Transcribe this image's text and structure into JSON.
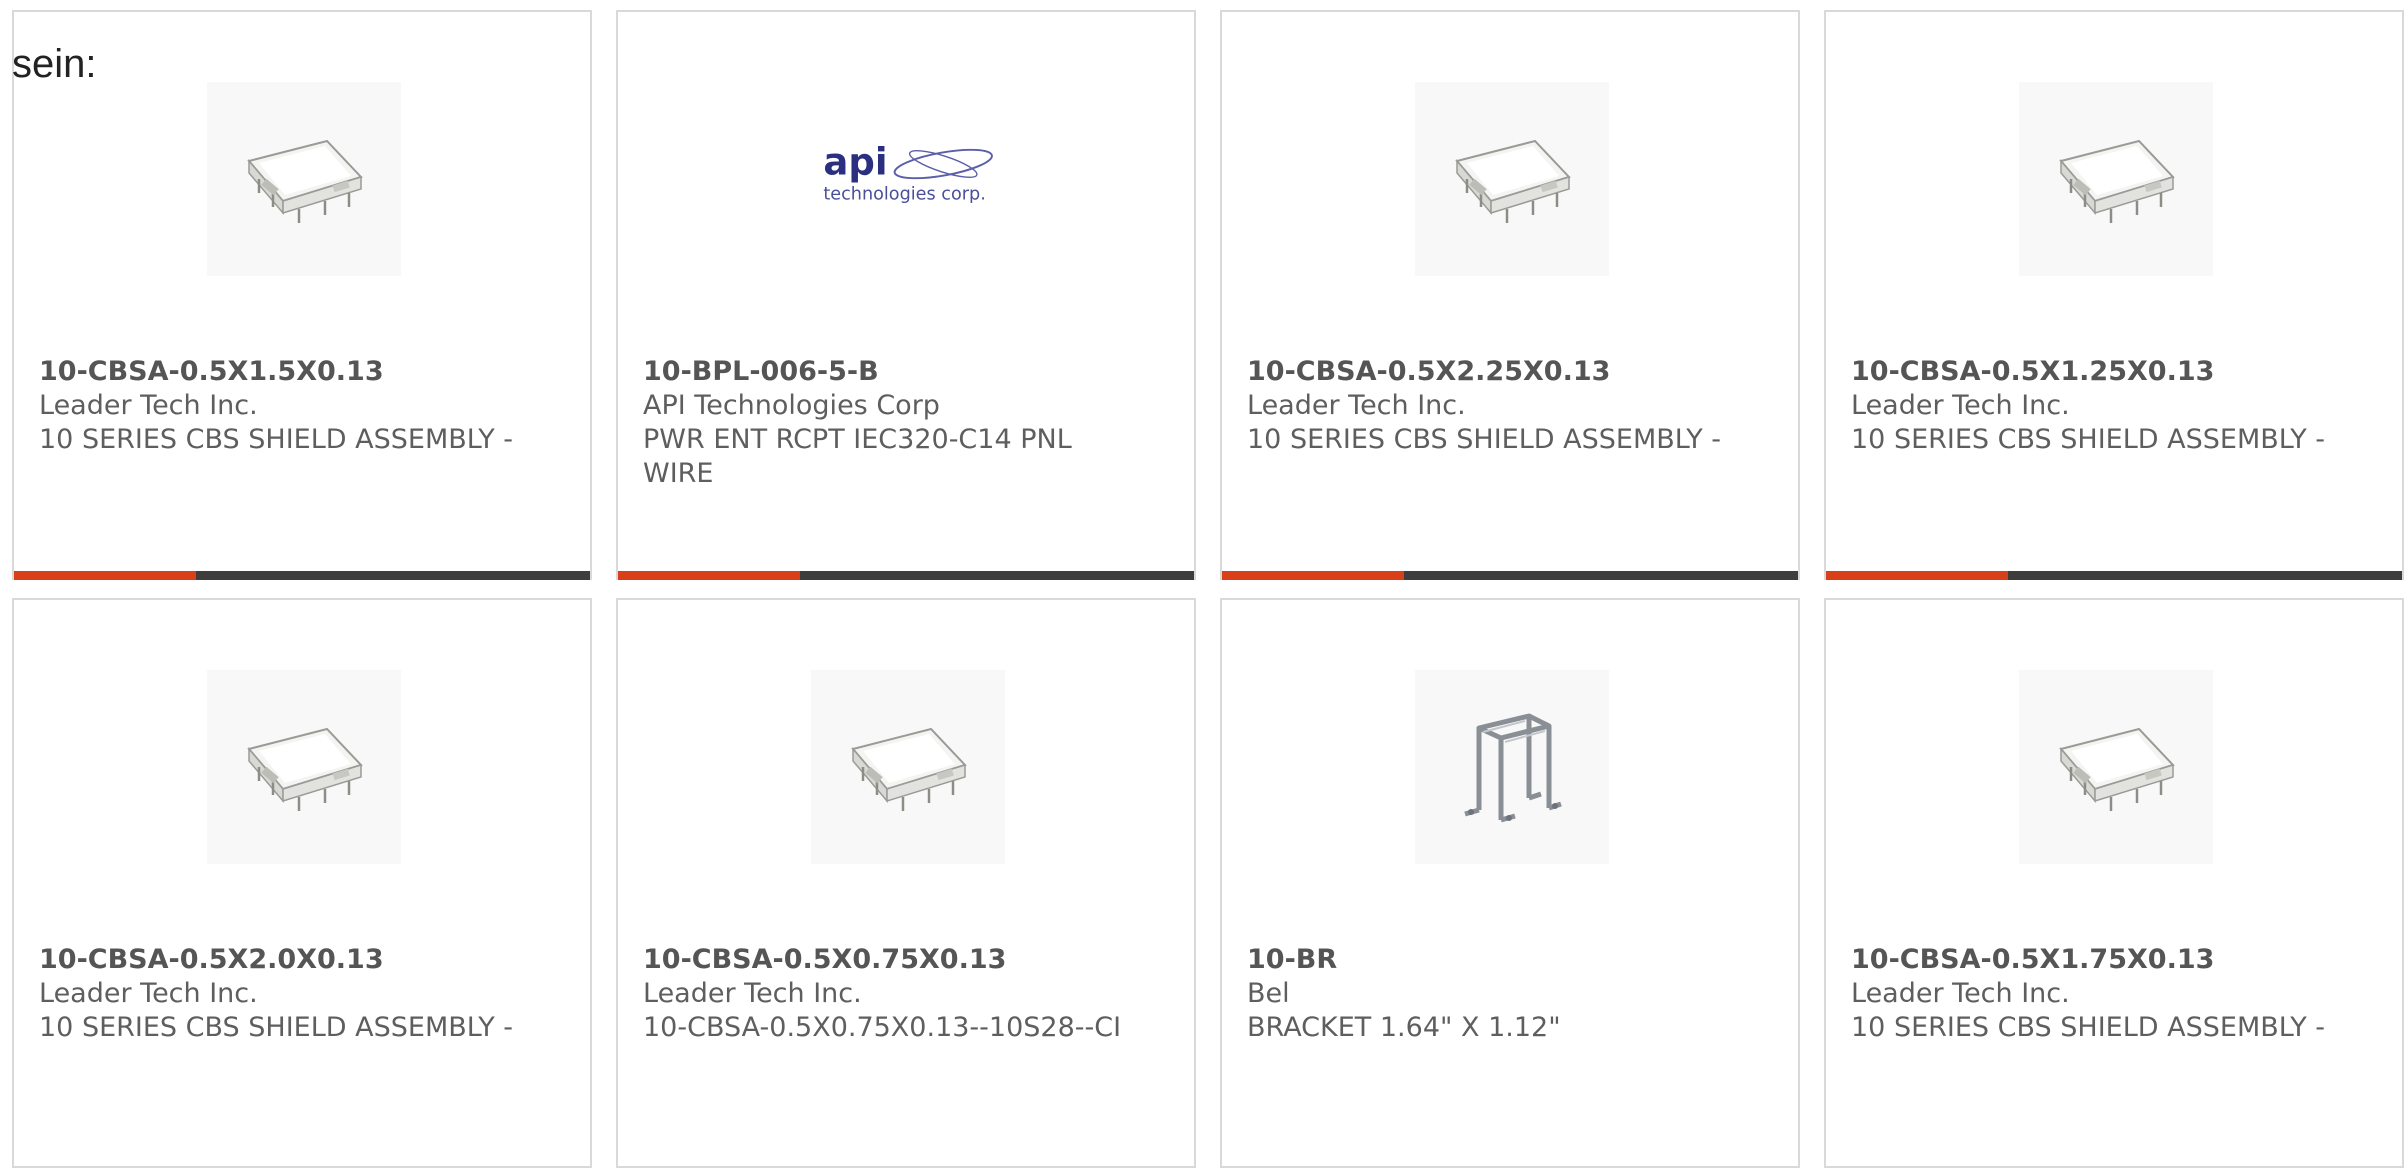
{
  "intro_text": "sein:",
  "products": [
    {
      "part": "10-CBSA-0.5X1.5X0.13",
      "manufacturer": "Leader Tech Inc.",
      "description": "10 SERIES CBS SHIELD ASSEMBLY -",
      "image_icon": "shield-can-icon"
    },
    {
      "part": "10-BPL-006-5-B",
      "manufacturer": "API Technologies Corp",
      "description": "PWR ENT RCPT IEC320-C14 PNL WIRE",
      "image_icon": "api-logo",
      "logo": {
        "brand": "api",
        "tagline": "technologies corp.",
        "color": "#2b2f7f"
      }
    },
    {
      "part": "10-CBSA-0.5X2.25X0.13",
      "manufacturer": "Leader Tech Inc.",
      "description": "10 SERIES CBS SHIELD ASSEMBLY -",
      "image_icon": "shield-can-icon"
    },
    {
      "part": "10-CBSA-0.5X1.25X0.13",
      "manufacturer": "Leader Tech Inc.",
      "description": "10 SERIES CBS SHIELD ASSEMBLY -",
      "image_icon": "shield-can-icon"
    },
    {
      "part": "10-CBSA-0.5X2.0X0.13",
      "manufacturer": "Leader Tech Inc.",
      "description": "10 SERIES CBS SHIELD ASSEMBLY -",
      "image_icon": "shield-can-icon"
    },
    {
      "part": "10-CBSA-0.5X0.75X0.13",
      "manufacturer": "Leader Tech Inc.",
      "description": "10-CBSA-0.5X0.75X0.13--10S28--CI",
      "image_icon": "shield-can-icon"
    },
    {
      "part": "10-BR",
      "manufacturer": "Bel",
      "description": "BRACKET 1.64\" X 1.12\"",
      "image_icon": "bracket-icon"
    },
    {
      "part": "10-CBSA-0.5X1.75X0.13",
      "manufacturer": "Leader Tech Inc.",
      "description": "10 SERIES CBS SHIELD ASSEMBLY -",
      "image_icon": "shield-can-icon"
    }
  ],
  "colors": {
    "accent": "#d9401a",
    "bar": "#3d3d3d",
    "border": "#d9d9d9",
    "text": "#5e5e5e"
  }
}
